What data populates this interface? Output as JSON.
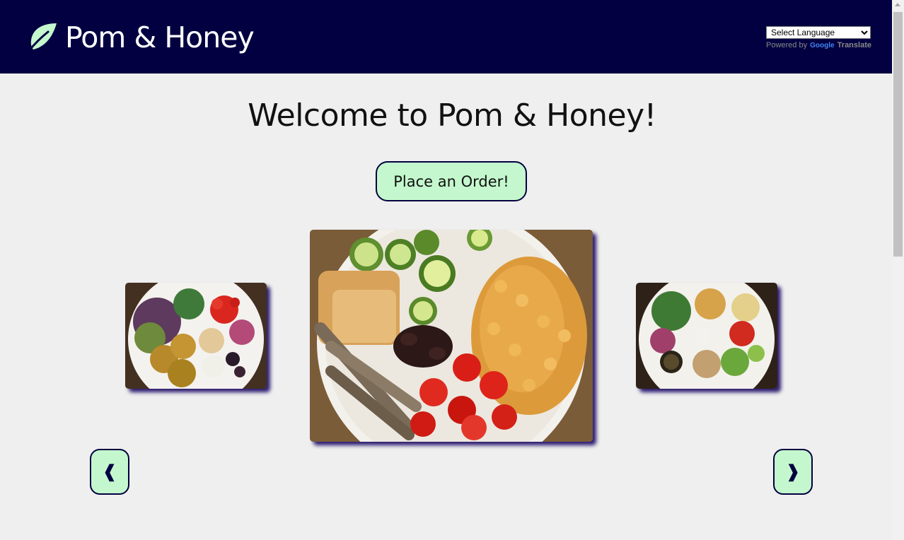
{
  "header": {
    "brand": "Pom & Honey",
    "logo_icon": "leaf-icon",
    "brand_color": "#020040",
    "accent_color": "#c4f7cd"
  },
  "translate": {
    "select_label": "Select Language",
    "powered_by": "Powered by",
    "google": "Google",
    "translate_word": "Translate"
  },
  "main": {
    "title": "Welcome to Pom & Honey!",
    "order_button": "Place an Order!"
  },
  "carousel": {
    "prev_label": "❰",
    "next_label": "❱",
    "images": [
      {
        "name": "falafel-salad-plate"
      },
      {
        "name": "chickpea-sardine-bowl"
      },
      {
        "name": "greens-chickpea-plate"
      }
    ]
  }
}
